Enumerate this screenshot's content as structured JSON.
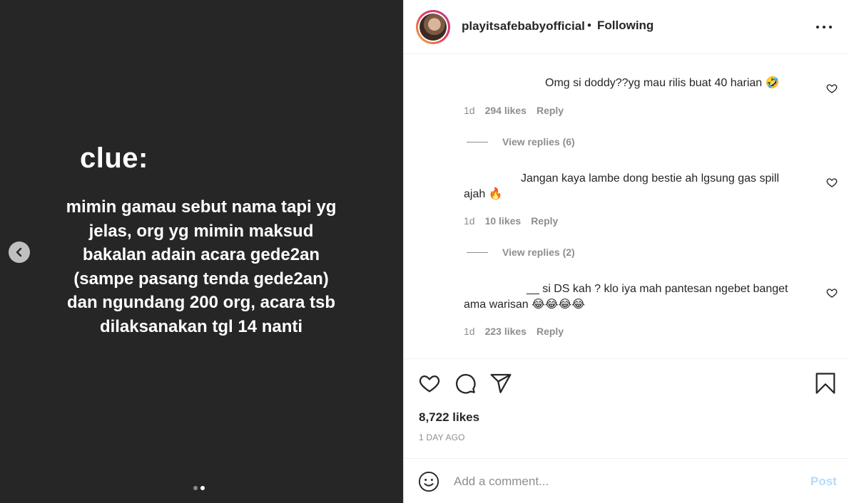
{
  "slide": {
    "title": "clue:",
    "lines": [
      "mimin gamau sebut nama tapi yg",
      "jelas, org yg mimin maksud",
      "bakalan adain acara gede2an",
      "(sampe pasang tenda gede2an)",
      "dan ngundang 200 org, acara tsb",
      "dilaksanakan tgl 14 nanti"
    ],
    "total_slides": 2,
    "active_slide": 2
  },
  "header": {
    "username": "playitsafebabyofficial",
    "separator": "•",
    "follow_state": "Following"
  },
  "comments": [
    {
      "text": "Omg si doddy??yg mau rilis buat 40 harian 🤣",
      "time": "1d",
      "likes": "294 likes",
      "reply": "Reply",
      "view_replies": "View replies (6)"
    },
    {
      "text_line1": "Jangan kaya lambe dong bestie ah lgsung gas spill",
      "text_line2": "ajah 🔥",
      "time": "1d",
      "likes": "10 likes",
      "reply": "Reply",
      "view_replies": "View replies (2)"
    },
    {
      "text_line1": "__ si DS kah ? klo iya mah pantesan ngebet banget",
      "text_line2": "ama warisan 😂😂😂😂",
      "time": "1d",
      "likes": "223 likes",
      "reply": "Reply"
    }
  ],
  "post": {
    "likes": "8,722 likes",
    "time_ago": "1 DAY AGO"
  },
  "add_comment": {
    "placeholder": "Add a comment...",
    "post_label": "Post"
  },
  "colors": {
    "media_bg": "#262626",
    "secondary_text": "#8e8e8e",
    "post_button_disabled": "#b3dbff"
  }
}
